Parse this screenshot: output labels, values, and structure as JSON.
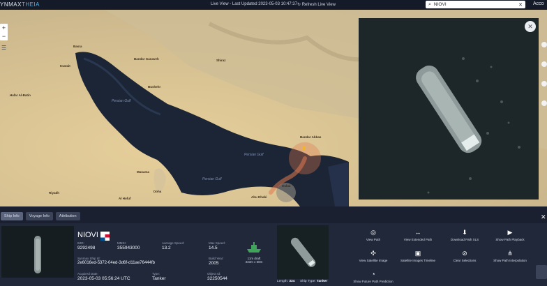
{
  "topbar": {
    "logo_a": "YNMAX",
    "logo_b": "THEIA",
    "live_view": "Live View - Last Updated 2023-05-03 10:47:37",
    "refresh": "Refresh Live View",
    "search_value": "NIOVI",
    "account": "Acco"
  },
  "map": {
    "places": [
      {
        "name": "Basra"
      },
      {
        "name": "Bandar Ganaveh"
      },
      {
        "name": "Bushehr"
      },
      {
        "name": "Kuwait"
      },
      {
        "name": "Bandar Abbas"
      },
      {
        "name": "Dubai"
      },
      {
        "name": "Abu Dhabi"
      },
      {
        "name": "Doha"
      },
      {
        "name": "Manama"
      },
      {
        "name": "Shiraz"
      },
      {
        "name": "Hafar Al-Batin"
      },
      {
        "name": "Al Hofuf"
      },
      {
        "name": "Riyadh"
      }
    ],
    "waters": [
      "Persian Gulf",
      "Persian Gulf",
      "Persian Gulf"
    ],
    "zoom_in": "+",
    "zoom_out": "−",
    "menu": "☰"
  },
  "popup": {
    "close": "✕"
  },
  "panel": {
    "tabs": [
      "Ship Info",
      "Voyage Info",
      "Attribution"
    ],
    "close": "✕",
    "ship_name": "NIOVI",
    "fields": {
      "imo_label": "IMO:",
      "imo": "9292498",
      "mmsi_label": "MMSI:",
      "mmsi": "355943000",
      "avg_speed_label": "Average Speed:",
      "avg_speed": "13.2",
      "max_speed_label": "Max Speed:",
      "max_speed": "14.5",
      "ship_id_label": "Synmax Ship Id:",
      "ship_id": "2e6016ed-5372-04ed-3d6f-d11ae76444fb",
      "build_year_label": "Build Year:",
      "build_year": "2005",
      "acquired_label": "Acquired Date:",
      "acquired": "2023-05-03 05:56:24 UTC",
      "type_label": "Type:",
      "type": "Tanker",
      "object_id_label": "Object Id:",
      "object_id": "32250544"
    },
    "draft_line1": "11m draft",
    "draft_line2": "333m x 58m",
    "length_label": "Length:",
    "length": "334",
    "ship_type_label": "Ship Type:",
    "ship_type": "Tanker",
    "actions": [
      {
        "label": "View Path",
        "icon": "◎"
      },
      {
        "label": "View Extended Path",
        "icon": "↔"
      },
      {
        "label": "Download Path XLS",
        "icon": "⬇"
      },
      {
        "label": "Show Path Playback",
        "icon": "▶"
      },
      {
        "label": "View Satellite Image",
        "icon": "✣"
      },
      {
        "label": "Satellite Images Timeline",
        "icon": "▣"
      },
      {
        "label": "Clear Selections",
        "icon": "⊘"
      },
      {
        "label": "Show Path Interpolation",
        "icon": "⋔"
      },
      {
        "label": "Show Future Path Prediction",
        "icon": "◔"
      }
    ]
  },
  "colors": {
    "accent": "#4fb6e8",
    "ship_marker": "#e07a4f",
    "panel_bg": "#20283a"
  }
}
